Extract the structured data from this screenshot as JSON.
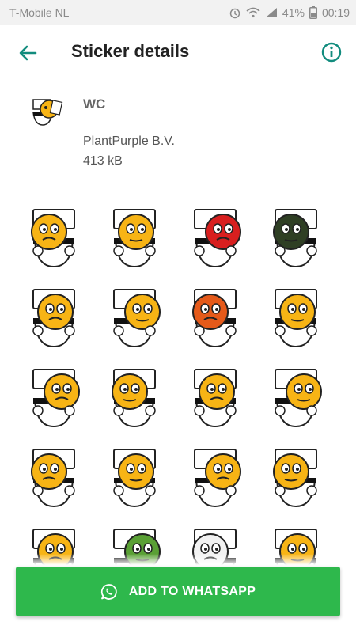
{
  "status_bar": {
    "carrier": "T-Mobile  NL",
    "battery": "41%",
    "time": "00:19",
    "icons": [
      "alarm-icon",
      "wifi-icon",
      "signal-icon",
      "battery-icon"
    ]
  },
  "app_bar": {
    "title": "Sticker details",
    "back_icon": "arrow-left-icon",
    "info_icon": "info-icon"
  },
  "pack": {
    "name": "WC",
    "publisher": "PlantPurple B.V.",
    "size": "413 kB"
  },
  "stickers": [
    "angry-face-toilet",
    "newspaper-face-toilet",
    "devil-face-toilet",
    "gasmask-face-toilet",
    "phone-face-toilet",
    "shocked-face-toilet",
    "angry-red-face-toilet",
    "lipstick-face-toilet",
    "burst-face-toilet",
    "green-splash-toilet",
    "thinking-face-toilet",
    "reading-newspaper-toilet",
    "vomit-face-toilet",
    "plunger-face-toilet",
    "toilet-roll-face-toilet",
    "crying-face-toilet",
    "angry-frown-toilet",
    "zombie-face-toilet",
    "mummy-face-toilet",
    "sink-face-toilet"
  ],
  "colors": {
    "accent": "#128c7e",
    "button": "#2eb84c",
    "face": "#f7b415"
  },
  "action": {
    "label": "ADD TO WHATSAPP",
    "icon": "whatsapp-icon"
  }
}
